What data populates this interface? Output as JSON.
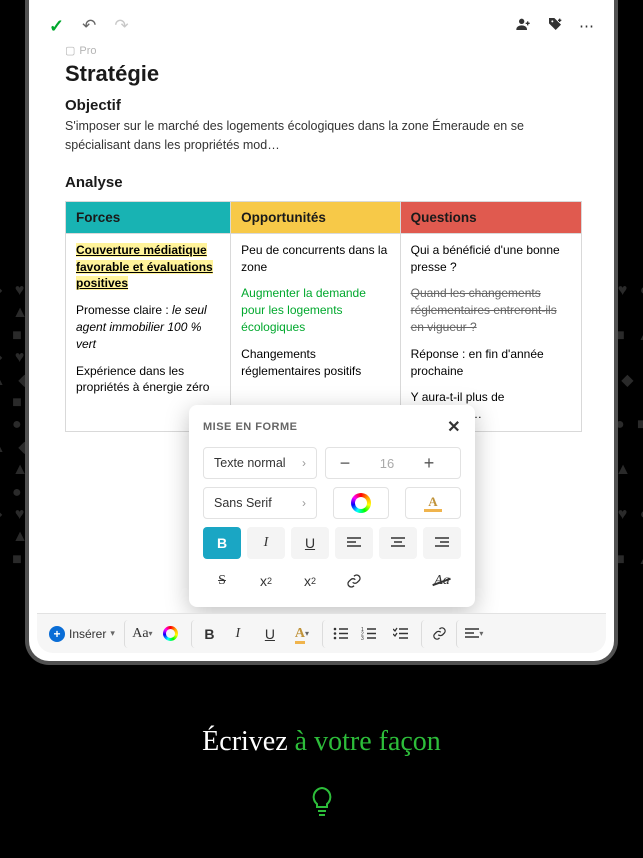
{
  "topbar": {},
  "doc": {
    "breadcrumb_icon": "▢",
    "breadcrumb": "Pro",
    "title": "Stratégie",
    "objective_heading": "Objectif",
    "objective_body": "S'imposer sur le marché des logements écologiques dans la zone Émeraude en se spécialisant dans les propriétés mod…",
    "analysis_heading": "Analyse"
  },
  "table": {
    "headers": {
      "forces": "Forces",
      "opps": "Opportunités",
      "questions": "Questions"
    },
    "forces": {
      "p1": "Couverture médiatique favorable et évaluations positives",
      "p2a": "Promesse claire : ",
      "p2b": "le seul agent immobilier 100 % vert",
      "p3": "Expérience dans les propriétés à énergie zéro"
    },
    "opps": {
      "p1": "Peu de concurrents dans la zone",
      "p2": "Augmenter la demande pour les logements écologiques",
      "p3": "Changements réglementaires positifs"
    },
    "questions": {
      "p1": "Qui a bénéficié d'une bonne presse ?",
      "p2": "Quand les changements réglementaires entreront-ils en vigueur ?",
      "p3": "Réponse : en fin d'année prochaine",
      "p4": "Y aura-t-il plus de concurrenc…"
    }
  },
  "popover": {
    "title": "MISE EN FORME",
    "text_style": "Texte normal",
    "font": "Sans Serif",
    "size": "16",
    "tools": {
      "bold": "B",
      "italic": "I",
      "underline": "U",
      "align_left": "≡",
      "align_center": "≡",
      "align_right": "≡",
      "strike": "S",
      "superscript_x": "x",
      "subscript_x": "x",
      "link": "🔗",
      "clear": "Aa"
    }
  },
  "toolbar": {
    "insert": "Insérer"
  },
  "hero": {
    "part1": "Écrivez ",
    "part2": "à votre façon"
  }
}
